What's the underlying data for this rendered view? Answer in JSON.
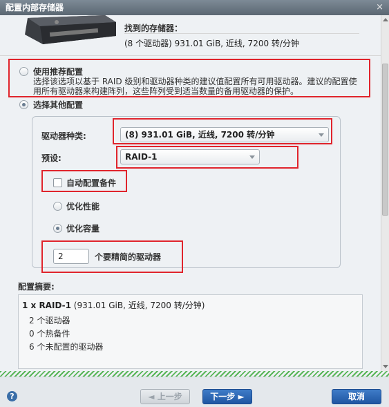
{
  "window": {
    "title": "配置内部存储器",
    "close_glyph": "×"
  },
  "header": {
    "found_label": "找到的存储器：",
    "found_value": "(8 个驱动器) 931.01 GiB, 近线, 7200 转/分钟"
  },
  "options": {
    "recommended": {
      "title": "使用推荐配置",
      "description": "选择该选项以基于 RAID 级别和驱动器种类的建议值配置所有可用驱动器。建议的配置使用所有驱动器来构建阵列，这些阵列受到适当数量的备用驱动器的保护。",
      "selected": false
    },
    "other": {
      "title": "选择其他配置",
      "selected": true
    }
  },
  "form": {
    "drive_type_label": "驱动器种类:",
    "drive_type_value": "(8) 931.01 GiB, 近线, 7200 转/分钟",
    "preset_label": "预设:",
    "preset_value": "RAID-1",
    "auto_spare_label": "自动配置备件",
    "auto_spare_checked": false,
    "optimize_performance_label": "优化性能",
    "optimize_capacity_label": "优化容量",
    "optimize_selected": "capacity",
    "drives_count": "2",
    "drives_count_label": "个要精简的驱动器"
  },
  "summary": {
    "title": "配置摘要:",
    "line1_bold": "1 x RAID-1",
    "line1_rest": " (931.01 GiB, 近线, 7200 转/分钟)",
    "lines": [
      "2 个驱动器",
      "0 个热备件",
      "6 个未配置的驱动器"
    ]
  },
  "footer": {
    "help_glyph": "?",
    "prev_label": "◄ 上一步",
    "next_label": "下一步 ►",
    "cancel_label": "取消"
  },
  "colors": {
    "annotation_red": "#e0242c",
    "primary_button": "#2a63b0",
    "titlebar": "#6b7782"
  }
}
